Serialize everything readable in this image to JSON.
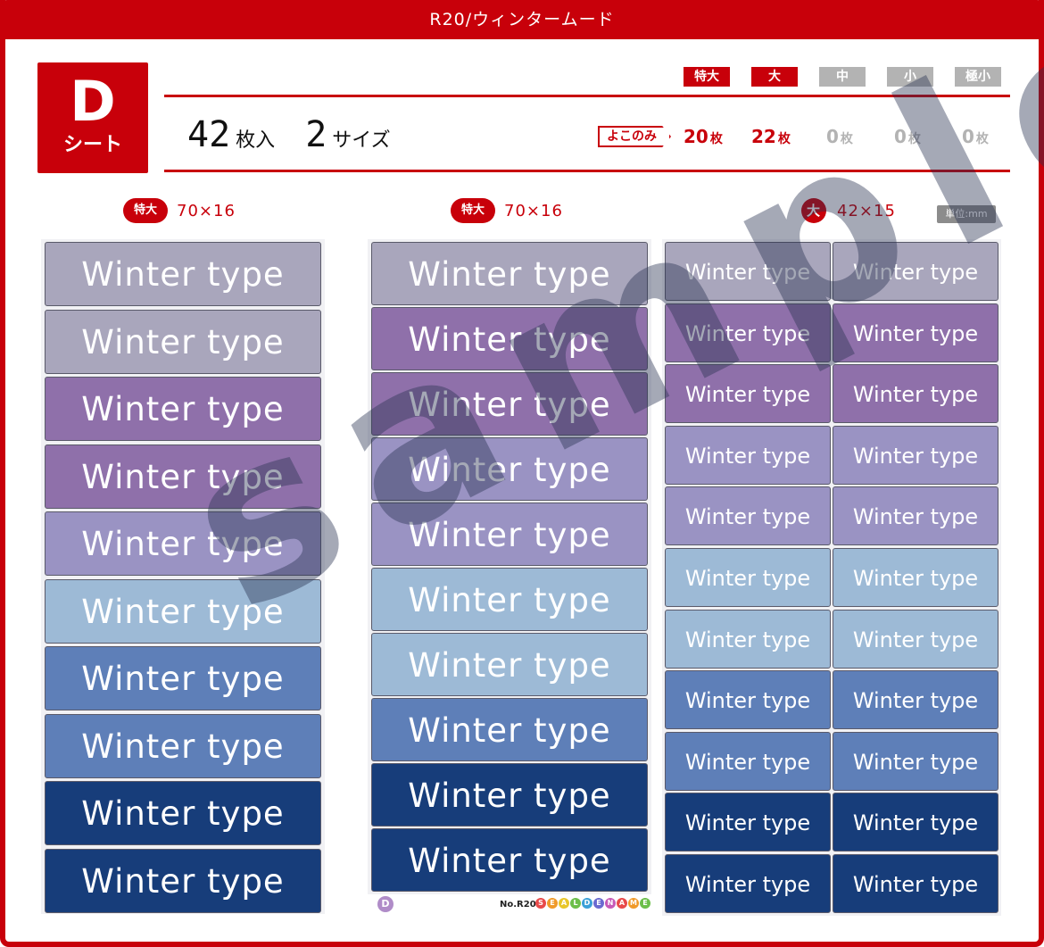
{
  "header": {
    "title": "R20/ウィンタームード"
  },
  "sheet": {
    "letter": "D",
    "word": "シート"
  },
  "counts": {
    "total_number": "42",
    "total_unit": "枚入",
    "sizes_number": "2",
    "sizes_unit": "サイズ"
  },
  "size_tags": [
    {
      "label": "特大",
      "active": true
    },
    {
      "label": "大",
      "active": true
    },
    {
      "label": "中",
      "active": false
    },
    {
      "label": "小",
      "active": false
    },
    {
      "label": "極小",
      "active": false
    }
  ],
  "yoko_label": "よこのみ",
  "quantities": [
    {
      "number": "20",
      "unit": "枚",
      "active": true
    },
    {
      "number": "22",
      "unit": "枚",
      "active": true
    },
    {
      "number": "0",
      "unit": "枚",
      "active": false
    },
    {
      "number": "0",
      "unit": "枚",
      "active": false
    },
    {
      "number": "0",
      "unit": "枚",
      "active": false
    }
  ],
  "columns": [
    {
      "badge": "特大",
      "dims": "70×16"
    },
    {
      "badge": "特大",
      "dims": "70×16"
    },
    {
      "badge": "大",
      "dims": "42×15"
    }
  ],
  "unit_note": "単位:mm",
  "label_text": "Winter type",
  "colors": {
    "brand_red": "#c8000a",
    "grey": "#a9a6bc",
    "purple": "#8f70aa",
    "lavender": "#9a93c3",
    "light_blue": "#9dbad6",
    "mid_blue": "#5e7fb8",
    "navy": "#173d7a"
  },
  "column1_colors": [
    "grey",
    "grey",
    "purple",
    "purple",
    "lavender",
    "light_blue",
    "mid_blue",
    "mid_blue",
    "navy",
    "navy"
  ],
  "column2_colors": [
    "grey",
    "purple",
    "purple",
    "lavender",
    "lavender",
    "light_blue",
    "light_blue",
    "mid_blue",
    "navy",
    "navy"
  ],
  "column3_colors": [
    "grey",
    "purple",
    "purple",
    "lavender",
    "lavender",
    "light_blue",
    "light_blue",
    "mid_blue",
    "mid_blue",
    "navy",
    "navy"
  ],
  "footer": {
    "sheet_mark": "D",
    "product_no": "No.R20",
    "logo_letters": [
      "S",
      "E",
      "A",
      "L",
      "D",
      "E",
      "N",
      "A",
      "M",
      "E"
    ]
  },
  "watermark": "sample"
}
